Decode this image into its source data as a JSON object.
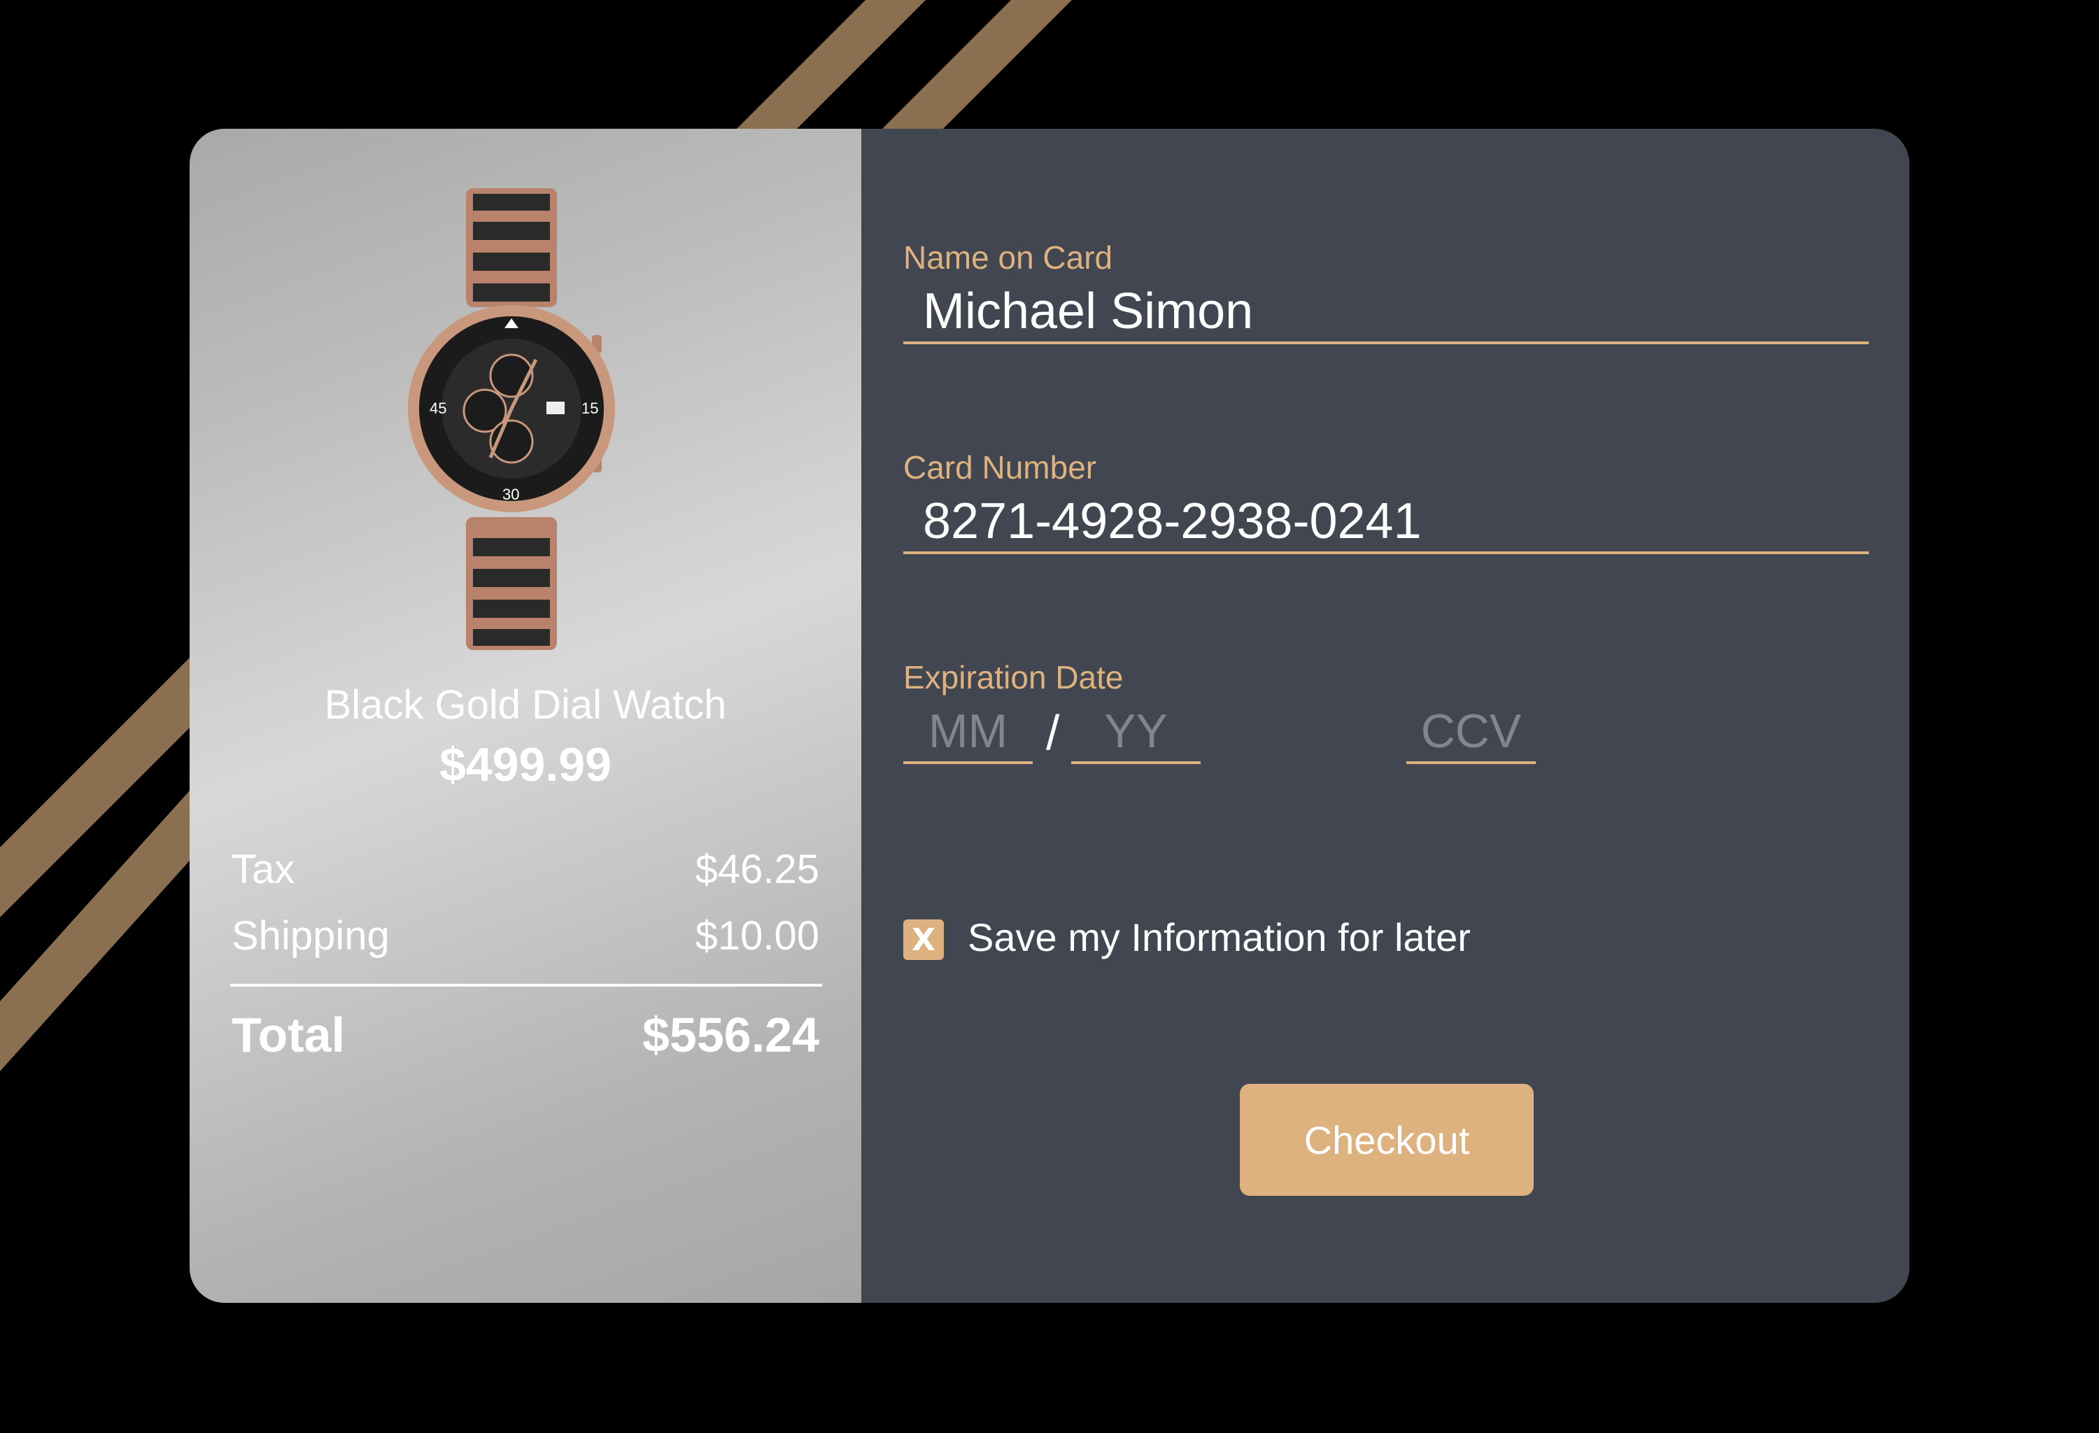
{
  "colors": {
    "background": "#000000",
    "stripe": "#8a7050",
    "accent": "#ddb27e",
    "panel_dark": "#414650",
    "text_light": "#ffffff"
  },
  "product": {
    "image_icon": "watch-image",
    "name": "Black Gold Dial Watch",
    "price": "$499.99"
  },
  "summary": {
    "tax_label": "Tax",
    "tax_value": "$46.25",
    "shipping_label": "Shipping",
    "shipping_value": "$10.00",
    "total_label": "Total",
    "total_value": "$556.24"
  },
  "form": {
    "name_label": "Name on Card",
    "name_value": "Michael Simon",
    "card_label": "Card Number",
    "card_value": "8271-4928-2938-0241",
    "expiration_label": "Expiration Date",
    "month_placeholder": "MM",
    "year_placeholder": "YY",
    "separator": "/",
    "ccv_placeholder": "CCV",
    "save_checked": true,
    "save_mark": "X",
    "save_label": "Save my Information for later",
    "checkout_label": "Checkout"
  }
}
